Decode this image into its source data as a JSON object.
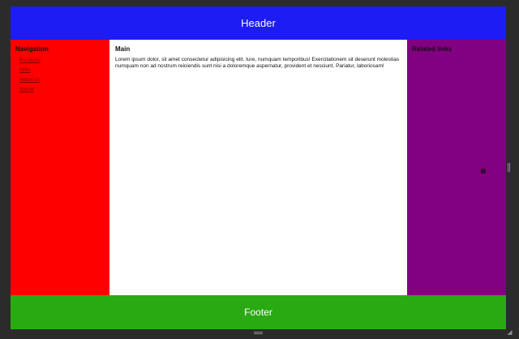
{
  "header": {
    "title": "Header"
  },
  "nav": {
    "title": "Navigation",
    "items": [
      {
        "label": "Products"
      },
      {
        "label": "Gifts"
      },
      {
        "label": "About us"
      },
      {
        "label": "Social"
      }
    ]
  },
  "main": {
    "title": "Main",
    "text": "Lorem ipsum dolor, sit amet consectetur adipisicing elit. Iure, numquam temporibus! Exercitationem sit deserunt molestias numquam non ad nostrum reiciendis sunt nisi a doloremque aspernatur, provident et nesciunt. Pariatur, laboriosam!"
  },
  "related": {
    "title": "Related links"
  },
  "footer": {
    "title": "Footer"
  },
  "colors": {
    "header": "#1d1cf5",
    "nav": "#ff0000",
    "main": "#ffffff",
    "related": "#820082",
    "footer": "#2aaa12"
  },
  "icons": {
    "horizontal_resize": "horizontal-resize-handle-icon",
    "vertical_resize": "vertical-resize-handle-icon",
    "corner_resize": "corner-resize-grip-icon"
  }
}
